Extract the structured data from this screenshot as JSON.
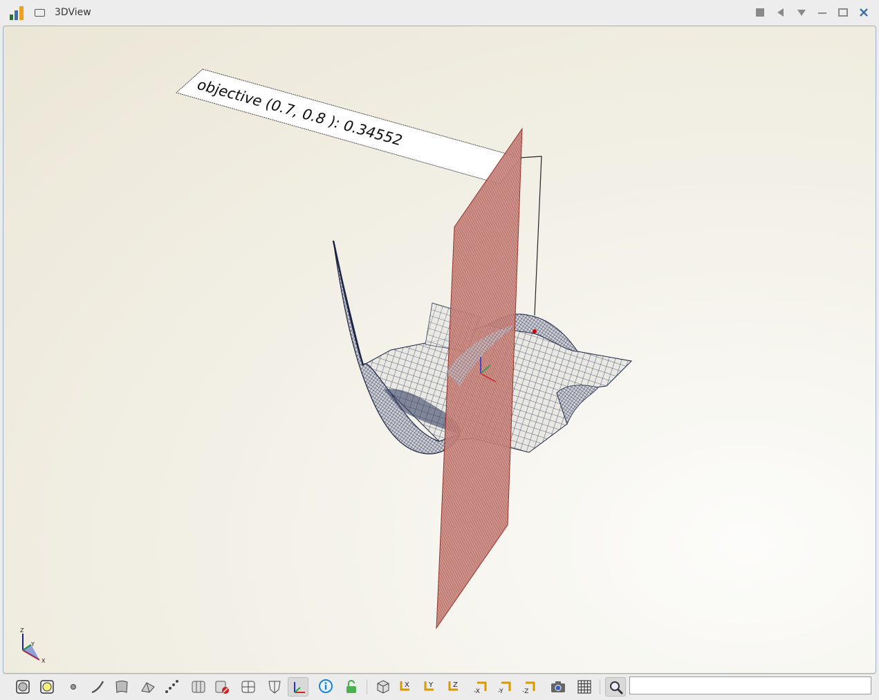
{
  "window": {
    "title": "3DView"
  },
  "annotation": {
    "text": "objective (0.7, 0.8 ): 0.34552"
  },
  "axis_triad": {
    "x_label": "X",
    "y_label": "Y",
    "z_label": "Z"
  },
  "colors": {
    "surface": "#1f2a4a",
    "slice_plane": "#a52a2a",
    "background": "#f3f1e8"
  },
  "toolbar": {
    "tools": [
      "view-all-icon",
      "fit-selection-icon",
      "point-icon",
      "curve-icon",
      "surface-icon",
      "mesh-icon",
      "dotted-line-icon",
      "cylinder-icon",
      "clip-icon",
      "grid-split-icon",
      "shield-icon",
      "axis-icon",
      "info-icon",
      "lock-icon",
      "cube-icon",
      "view-x-icon",
      "view-y-icon",
      "view-z-icon",
      "view-minus-x-icon",
      "view-minus-y-icon",
      "view-minus-z-icon",
      "camera-icon",
      "grid-icon",
      "search-icon"
    ],
    "axis_buttons": {
      "x": "X",
      "y": "Y",
      "z": "Z",
      "mx": "-X",
      "my": "-Y",
      "mz": "-Z"
    },
    "search_value": ""
  }
}
